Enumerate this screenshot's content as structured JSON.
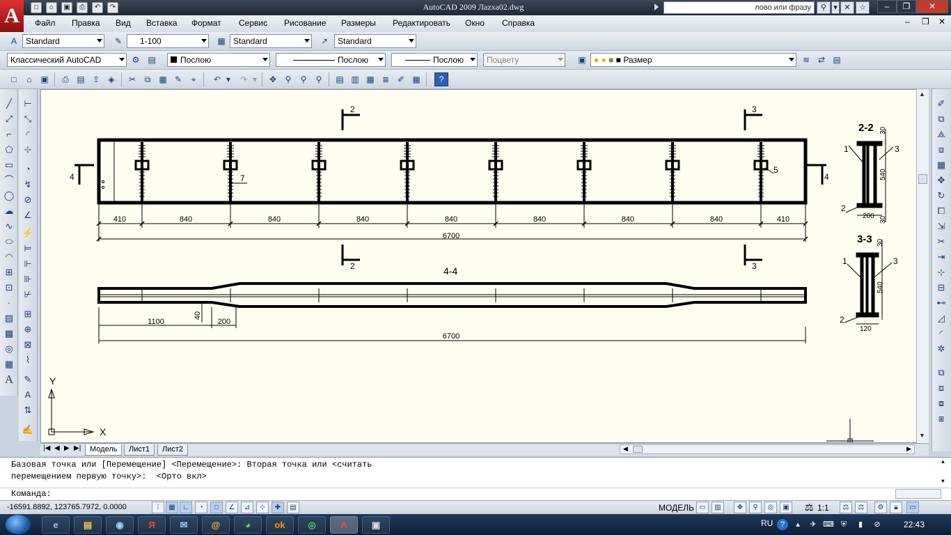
{
  "window": {
    "title": "AutoCAD 2009 Лаzха02.dwg",
    "search_placeholder": "лово или фразу"
  },
  "app_logo": "A",
  "menu": [
    "Файл",
    "Правка",
    "Вид",
    "Вставка",
    "Формат",
    "Сервис",
    "Рисование",
    "Размеры",
    "Редактировать",
    "Окно",
    "Справка"
  ],
  "toolbar_styles": {
    "text_style": "Standard",
    "dim_scale": "1-100",
    "table_style": "Standard",
    "multileader_style": "Standard"
  },
  "toolbar_layers": {
    "workspace": "Классический AutoCAD",
    "color": "Послою",
    "linetype": "Послою",
    "lineweight": "Послою",
    "plotstyle": "Поцвету",
    "layer": "Размер"
  },
  "drawing": {
    "section_labels": {
      "s2_top": "2",
      "s3_top": "3",
      "s2_bot": "2",
      "s3_bot": "3",
      "s4_left": "4",
      "s4_right": "4"
    },
    "callouts": {
      "c7": "7",
      "c5": "5"
    },
    "dims_top": [
      "410",
      "840",
      "840",
      "840",
      "840",
      "840",
      "840",
      "840",
      "410"
    ],
    "dim_total_top": "6700",
    "view_4_4_title": "4-4",
    "dims_bottom": {
      "d1100": "1100",
      "d40": "40",
      "d200": "200",
      "total": "6700"
    },
    "section_22": {
      "title": "2-2",
      "n1": "1",
      "n2": "2",
      "n3": "3",
      "h540": "540",
      "t30a": "30",
      "t30b": "30",
      "w200": "200"
    },
    "section_33": {
      "title": "3-3",
      "n1": "1",
      "n2": "2",
      "n3": "3",
      "h540": "540",
      "t30": "30",
      "w120": "120"
    },
    "ucs": {
      "x": "X",
      "y": "Y"
    }
  },
  "layout_tabs": [
    "Модель",
    "Лист1",
    "Лист2"
  ],
  "command": {
    "line1": "Базовая точка или [Перемещение] <Перемещение>: Вторая точка или <считать",
    "line2": "перемещением первую точку>:  <Орто вкл>",
    "prompt": "Команда:"
  },
  "status": {
    "coords": "-16591.8892, 123765.7972, 0.0000",
    "space": "МОДЕЛЬ",
    "annotation_scale": "1:1"
  },
  "taskbar": {
    "lang": "RU",
    "clock": "22:43"
  }
}
